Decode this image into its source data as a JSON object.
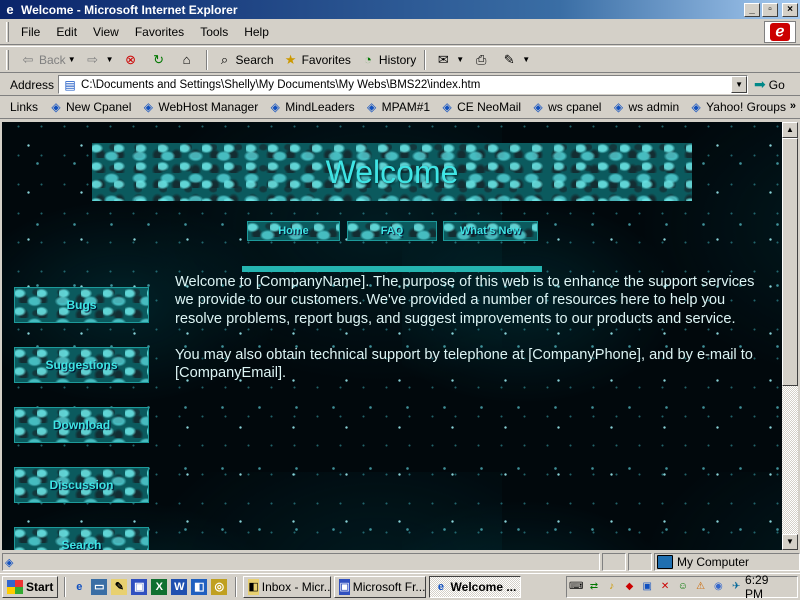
{
  "window": {
    "title": "Welcome - Microsoft Internet Explorer",
    "buttons": {
      "minimize": "_",
      "maximize": "▫",
      "close": "×"
    }
  },
  "menubar": {
    "items": [
      "File",
      "Edit",
      "View",
      "Favorites",
      "Tools",
      "Help"
    ]
  },
  "toolbar": {
    "back_label": "Back",
    "search_label": "Search",
    "favorites_label": "Favorites",
    "history_label": "History"
  },
  "address": {
    "label": "Address",
    "value": "C:\\Documents and Settings\\Shelly\\My Documents\\My Webs\\BMS22\\index.htm",
    "go_label": "Go"
  },
  "links": {
    "label": "Links",
    "items": [
      "New Cpanel",
      "WebHost Manager",
      "MindLeaders",
      "MPAM#1",
      "CE NeoMail",
      "ws cpanel",
      "ws admin",
      "Yahoo! Groups"
    ],
    "more": "»"
  },
  "page": {
    "banner": "Welcome",
    "nav": {
      "home": "Home",
      "faq": "FAQ",
      "whats_new": "What's New"
    },
    "sidebar": {
      "bugs": "Bugs",
      "suggestions": "Suggestions",
      "download": "Download",
      "discussion": "Discussion",
      "search": "Search"
    },
    "paragraph1": "Welcome to [CompanyName]. The purpose of this web is to enhance the support services we provide to our customers. We've provided a number of resources here to help you resolve problems, report bugs, and suggest improvements to our products and service.",
    "paragraph2": "You may also obtain technical support by telephone at [CompanyPhone], and by e-mail to [CompanyEmail]."
  },
  "status": {
    "zone": "My Computer"
  },
  "taskbar": {
    "start_label": "Start",
    "tasks": [
      "Inbox - Micr...",
      "Microsoft Fr...",
      "Welcome ..."
    ],
    "clock": "6:29 PM"
  },
  "colors": {
    "accent_teal": "#3fe4e4",
    "page_background": "#01080c",
    "titlebar": "#0a246a"
  }
}
